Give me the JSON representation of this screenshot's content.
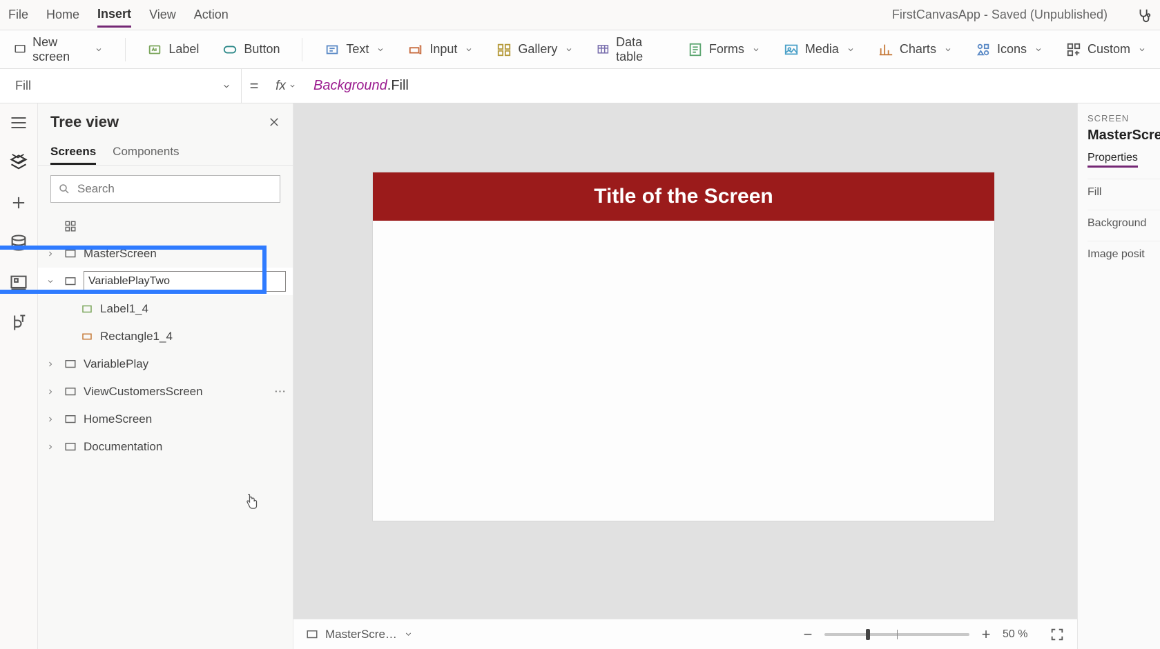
{
  "menubar": {
    "items": [
      "File",
      "Home",
      "Insert",
      "View",
      "Action"
    ],
    "activeIndex": 2,
    "appTitle": "FirstCanvasApp - Saved (Unpublished)"
  },
  "ribbon": {
    "newScreen": "New screen",
    "label": "Label",
    "button": "Button",
    "text": "Text",
    "input": "Input",
    "gallery": "Gallery",
    "dataTable": "Data table",
    "forms": "Forms",
    "media": "Media",
    "charts": "Charts",
    "icons": "Icons",
    "custom": "Custom"
  },
  "formula": {
    "property": "Fill",
    "eq": "=",
    "fx": "fx",
    "obj": "Background",
    "dot": ".",
    "prop": "Fill"
  },
  "treeview": {
    "title": "Tree view",
    "tabs": {
      "screens": "Screens",
      "components": "Components"
    },
    "searchPlaceholder": "Search",
    "app": "App",
    "nodes": {
      "master": "MasterScreen",
      "renameValue": "VariablePlayTwo",
      "label1_4": "Label1_4",
      "rectangle1_4": "Rectangle1_4",
      "variablePlay": "VariablePlay",
      "viewCustomers": "ViewCustomersScreen",
      "homeScreen": "HomeScreen",
      "documentation": "Documentation"
    }
  },
  "canvas": {
    "bannerText": "Title of the Screen",
    "bannerColor": "#9b1b1b"
  },
  "properties": {
    "caption": "SCREEN",
    "name": "MasterScre",
    "tab": "Properties",
    "rows": [
      "Fill",
      "Background",
      "Image posit"
    ]
  },
  "status": {
    "selection": "MasterScre…",
    "zoomPct": "50  %"
  }
}
